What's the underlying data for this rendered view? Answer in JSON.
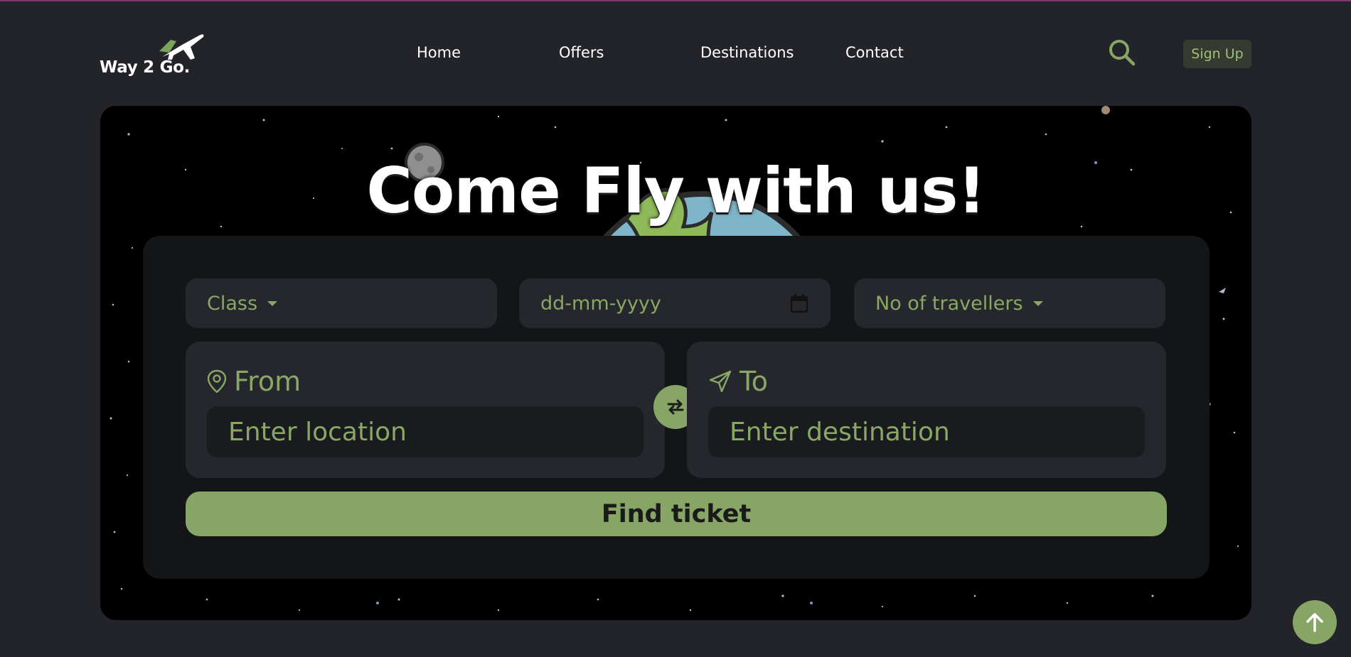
{
  "brand": {
    "logo_text": "Way 2 Go.",
    "logo_icon": "airplane-icon"
  },
  "nav": {
    "items": [
      {
        "label": "Home"
      },
      {
        "label": "Offers"
      },
      {
        "label": "Destinations"
      },
      {
        "label": "Contact"
      }
    ],
    "search_icon": "search-icon",
    "signup_label": "Sign Up"
  },
  "hero": {
    "title": "Come Fly with us!"
  },
  "search_form": {
    "class_select": {
      "label": "Class"
    },
    "date_input": {
      "placeholder": "dd-mm-yyyy",
      "icon": "calendar-icon"
    },
    "travellers_select": {
      "label": "No of travellers"
    },
    "from": {
      "label": "From",
      "placeholder": "Enter location",
      "icon": "map-pin-icon"
    },
    "to": {
      "label": "To",
      "placeholder": "Enter destination",
      "icon": "send-icon"
    },
    "swap_icon": "swap-arrows-icon",
    "submit_label": "Find ticket"
  },
  "scroll_top_icon": "arrow-up-icon",
  "colors": {
    "background": "#222429",
    "accent": "#87a564",
    "accent_text": "#8aa766",
    "panel": "#141517",
    "field": "#25272d"
  }
}
